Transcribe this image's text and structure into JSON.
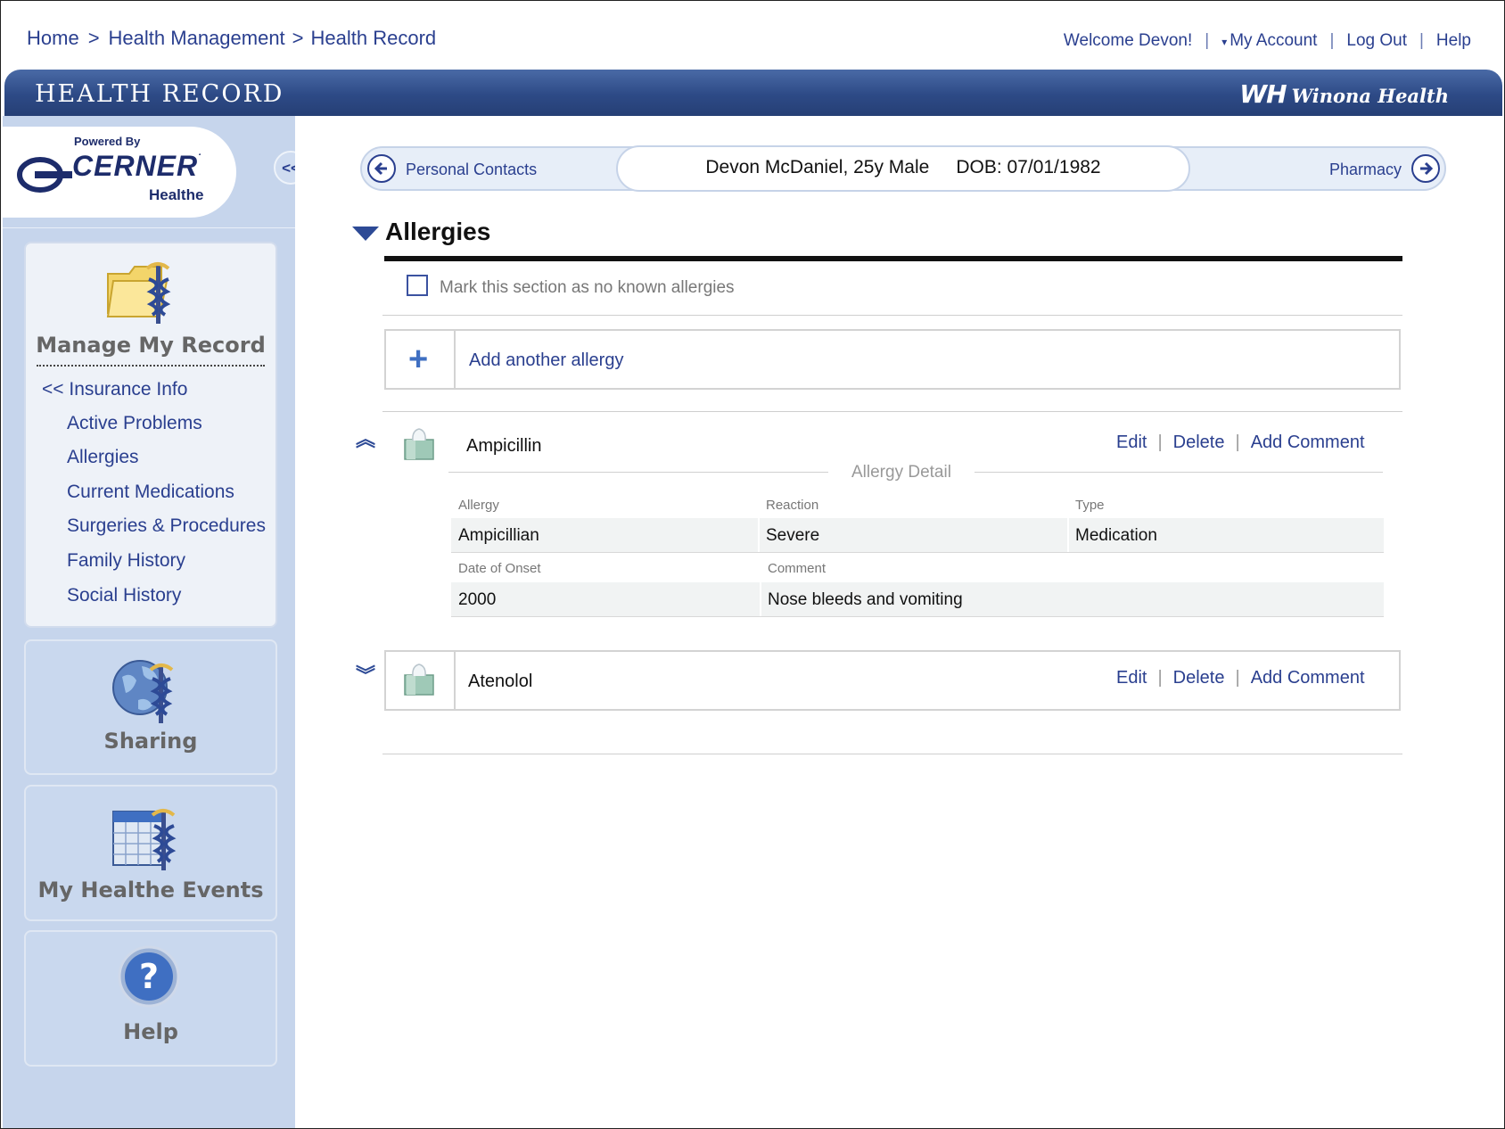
{
  "breadcrumb": {
    "home": "Home",
    "sep": ">",
    "health_management": "Health Management",
    "sep2": ">",
    "health_record": "Health Record"
  },
  "account": {
    "welcome": "Welcome Devon!",
    "caret": "▾",
    "my_account": "My Account",
    "logout": "Log Out",
    "help": "Help"
  },
  "titlebar": {
    "title": "HEALTH RECORD",
    "brand_mark": "WH",
    "brand_name": "Winona Health"
  },
  "logo": {
    "powered_by": "Powered By",
    "cerner": "CERNER",
    "healthe": "Healthe",
    "reg": "·"
  },
  "sidebar": {
    "collapse_label": "<<",
    "manage": {
      "title": "Manage My Record",
      "back_link": "<< Insurance Info",
      "items": [
        {
          "label": "Active Problems"
        },
        {
          "label": "Allergies"
        },
        {
          "label": "Current Medications"
        },
        {
          "label": "Surgeries & Procedures"
        },
        {
          "label": "Family History"
        },
        {
          "label": "Social History"
        }
      ]
    },
    "sharing": {
      "title": "Sharing"
    },
    "events": {
      "title": "My Healthe Events"
    },
    "help": {
      "title": "Help"
    }
  },
  "context_bar": {
    "prev_label": "Personal Contacts",
    "next_label": "Pharmacy",
    "patient": "Devon McDaniel, 25y Male",
    "dob": "DOB: 07/01/1982"
  },
  "section": {
    "title": "Allergies",
    "no_known_label": "Mark this section as no known allergies",
    "no_known_checked": false,
    "add_label": "Add another allergy"
  },
  "allergies": [
    {
      "name": "Ampicillin",
      "expanded": true,
      "actions": {
        "edit": "Edit",
        "delete": "Delete",
        "comment": "Add Comment"
      },
      "detail": {
        "legend": "Allergy Detail",
        "labels": {
          "allergy": "Allergy",
          "reaction": "Reaction",
          "type": "Type",
          "onset": "Date of Onset",
          "comment": "Comment"
        },
        "values": {
          "allergy": "Ampicillian",
          "reaction": "Severe",
          "type": "Medication",
          "onset": "2000",
          "comment": "Nose bleeds and vomiting"
        }
      }
    },
    {
      "name": "Atenolol",
      "expanded": false,
      "actions": {
        "edit": "Edit",
        "delete": "Delete",
        "comment": "Add Comment"
      }
    }
  ],
  "colors": {
    "link": "#2a3f8f",
    "titlebar": "#2d4a86",
    "sidebar": "#c6d5ec",
    "accent_plus": "#3f6fc2"
  },
  "icons": {
    "manage": "folder-caduceus-icon",
    "sharing": "globe-caduceus-icon",
    "events": "calendar-caduceus-icon",
    "help": "question-icon",
    "allergy_item": "tissue-box-icon",
    "prev": "arrow-left-icon",
    "next": "arrow-right-icon",
    "add": "plus-icon"
  }
}
